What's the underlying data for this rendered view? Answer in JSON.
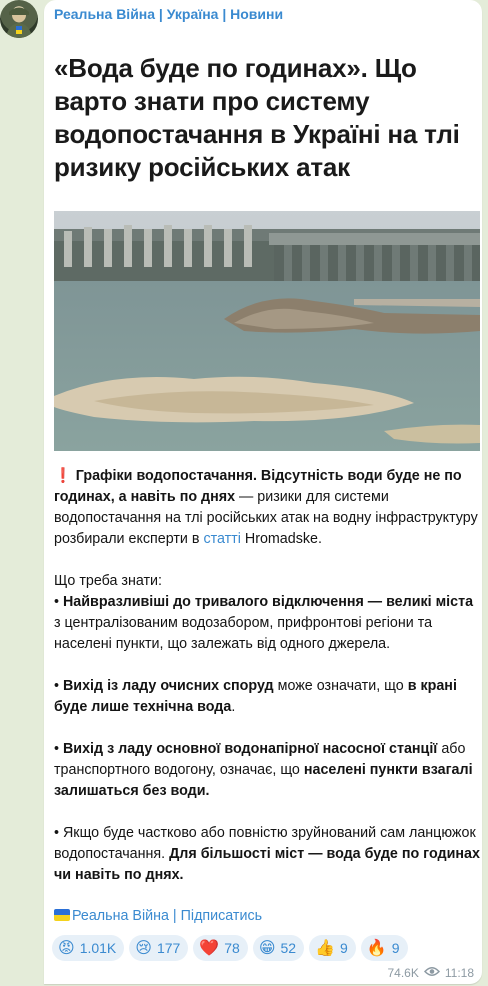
{
  "post": {
    "channel_name": "Реальна Війна | Україна | Новини",
    "headline": "«Вода буде по годинах». Що варто знати про систему водопостачання в Україні на тлі ризику російських атак",
    "intro": {
      "emoji": "❗️",
      "bold1": "Графіки водопостачання. Відсутність води буде не по годинах, а навіть по днях",
      "text1": " — ризики для системи водопостачання на тлі російських атак на водну інфраструктуру розбирали експерти в ",
      "link": "статті",
      "text2": " Hromadske."
    },
    "what_to_know": "Що треба знати:",
    "bullets": [
      {
        "prefix": "• ",
        "b1": "Найвразливіші до тривалого відключення — великі міста",
        "t1": " з централізованим водозабором, прифронтові регіони та населені пункти, що залежать від одного джерела."
      },
      {
        "prefix": "• ",
        "b1": "Вихід із ладу очисних споруд",
        "t1": " може означати, що ",
        "b2": "в крані буде лише технічна вода",
        "t2": "."
      },
      {
        "prefix": "• ",
        "b1": "Вихід з ладу основної водонапірної насосної станції",
        "t1": " або транспортного водогону, означає, що ",
        "b2": "населені пункти взагалі залишаться без води."
      },
      {
        "prefix": "• ",
        "t1": "Якщо буде частково або повністю зруйнований сам ланцюжок водопостачання. ",
        "b2": "Для більшості міст — вода буде по годинах чи навіть по днях."
      }
    ],
    "subscribe_link": "Реальна Війна | Підписатись",
    "reactions": [
      {
        "emoji": "😡",
        "count": "1.01K"
      },
      {
        "emoji": "😢",
        "count": "177"
      },
      {
        "emoji": "❤️",
        "count": "78"
      },
      {
        "emoji": "😁",
        "count": "52"
      },
      {
        "emoji": "👍",
        "count": "9"
      },
      {
        "emoji": "🔥",
        "count": "9"
      }
    ],
    "views": "74.6K",
    "time": "11:18"
  },
  "colors": {
    "background": "#e4ecd9",
    "bubble": "#ffffff",
    "accent": "#3a8ad0",
    "reaction_bg": "#e7f0f8",
    "meta": "#8d9aa3"
  },
  "icons": {
    "views": "eye-icon",
    "flag": "ukraine-flag-icon"
  }
}
